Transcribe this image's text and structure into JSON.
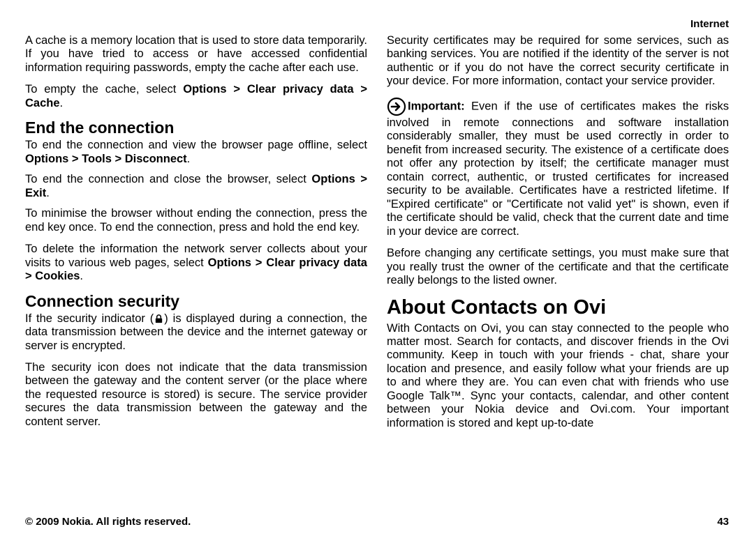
{
  "header": {
    "section": "Internet"
  },
  "left": {
    "p1a": "A cache is a memory location that is used to store data temporarily. If you have tried to access or have accessed confidential information requiring passwords, empty the cache after each use.",
    "p1b_pre": "To empty the cache, select ",
    "p1b_b1": "Options",
    "p1b_gt1": "  >  ",
    "p1b_b2": "Clear privacy data",
    "p1b_gt2": "  >  ",
    "p1b_b3": "Cache",
    "p1b_end": ".",
    "h2a": "End the connection",
    "p2a_pre": "To end the connection and view the browser page offline, select ",
    "p2a_b1": "Options",
    "p2a_gt1": "  >  ",
    "p2a_b2": "Tools",
    "p2a_gt2": "  >  ",
    "p2a_b3": "Disconnect",
    "p2a_end": ".",
    "p2b_pre": "To end the connection and close the browser, select ",
    "p2b_b1": "Options",
    "p2b_gt1": "  >  ",
    "p2b_b2": "Exit",
    "p2b_end": ".",
    "p2c": "To minimise the browser without ending the connection, press the end key once. To end the connection, press and hold the end key.",
    "p2d_pre": "To delete the information the network server collects about your visits to various web pages, select ",
    "p2d_b1": "Options",
    "p2d_gt1": "  >  ",
    "p2d_b2": "Clear privacy data",
    "p2d_gt2": "  >  ",
    "p2d_b3": "Cookies",
    "p2d_end": ".",
    "h2b": "Connection security",
    "p3a_pre": "If the security indicator (",
    "p3a_post": ") is displayed during a connection, the data transmission between the device and the internet gateway or server is encrypted.",
    "p3b": "The security icon does not indicate that the data transmission between the gateway and the content server (or the place where the requested resource is stored) is secure. The service provider secures the data transmission between the gateway and the content server."
  },
  "right": {
    "p1": "Security certificates may be required for some services, such as banking services. You are notified if the identity of the server is not authentic or if you do not have the correct security certificate in your device. For more information, contact your service provider.",
    "imp_label": "Important:",
    "imp_text": "  Even if the use of certificates makes the risks involved in remote connections and software installation considerably smaller, they must be used correctly in order to benefit from increased security. The existence of a certificate does not offer any protection by itself; the certificate manager must contain correct, authentic, or trusted certificates for increased security to be available. Certificates have a restricted lifetime. If \"Expired certificate\" or \"Certificate not valid yet\" is shown, even if the certificate should be valid, check that the current date and time in your device are correct.",
    "p2": "Before changing any certificate settings, you must make sure that you really trust the owner of the certificate and that the certificate really belongs to the listed owner.",
    "h1": "About Contacts on Ovi",
    "p3": "With Contacts on Ovi, you can stay connected to the people who matter most. Search for contacts, and discover friends in the Ovi community. Keep in touch with your friends - chat, share your location and presence, and easily follow what your friends are up to and where they are. You can even chat with friends who use Google Talk™. Sync your contacts, calendar, and other content between your Nokia device and Ovi.com. Your important information is stored and kept up-to-date"
  },
  "footer": {
    "copyright": "© 2009 Nokia. All rights reserved.",
    "page": "43"
  }
}
